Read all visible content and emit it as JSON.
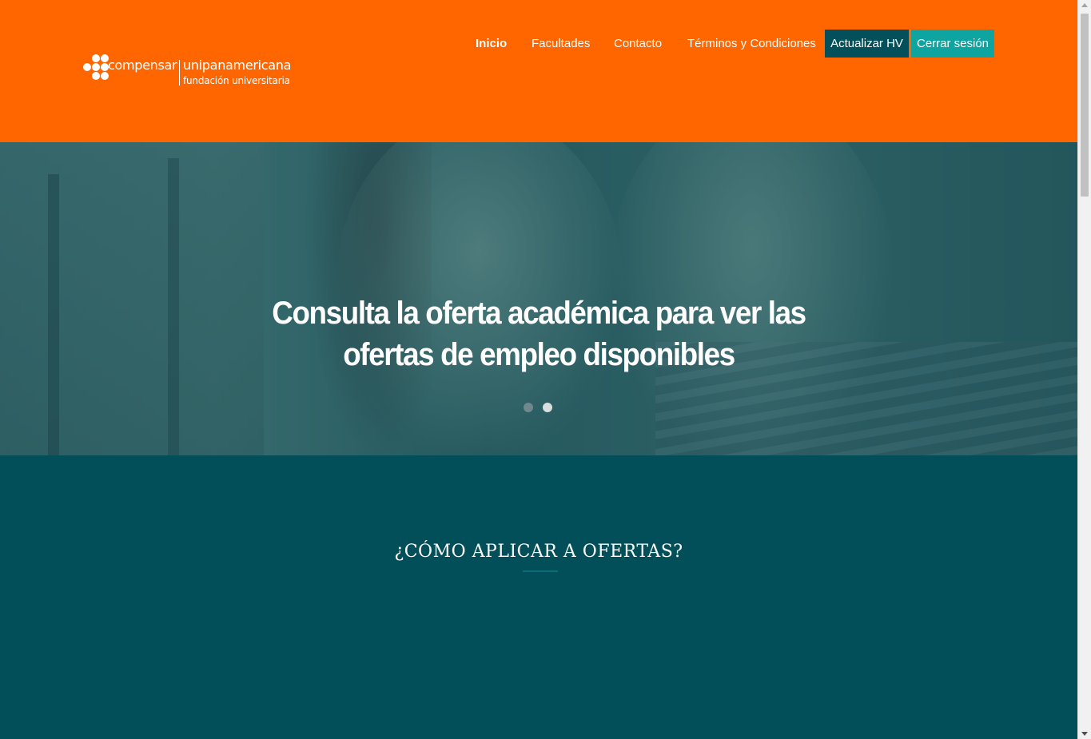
{
  "logo": {
    "brand": "compensar",
    "name": "unipanamericana",
    "subtitle": "fundación universitaria"
  },
  "nav": {
    "items": [
      {
        "label": "Inicio",
        "active": true
      },
      {
        "label": "Facultades",
        "active": false
      },
      {
        "label": "Contacto",
        "active": false
      },
      {
        "label": "Términos y Condiciones",
        "active": false
      }
    ],
    "update_cv_label": "Actualizar HV",
    "logout_label": "Cerrar sesión"
  },
  "hero": {
    "title_line1": "Consulta la oferta académica para ver las",
    "title_line2": "ofertas de empleo disponibles",
    "slides_count": 2,
    "active_slide": 2
  },
  "howto": {
    "title": "¿CÓMO APLICAR A OFERTAS?"
  },
  "colors": {
    "header_bg": "#ff6600",
    "update_cv_bg": "#04505a",
    "logout_bg": "#0ea5a1",
    "section_bg": "#034f59"
  }
}
